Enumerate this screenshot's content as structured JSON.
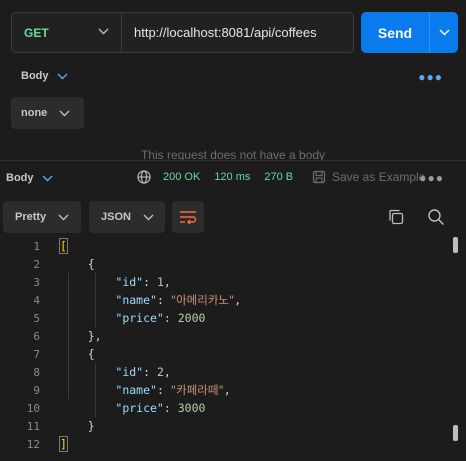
{
  "request": {
    "method": "GET",
    "url": "http://localhost:8081/api/coffees",
    "send_label": "Send"
  },
  "request_body": {
    "tab_label": "Body",
    "type_value": "none",
    "empty_message": "This request does not have a body"
  },
  "response": {
    "tab_label": "Body",
    "status": "200 OK",
    "time": "120 ms",
    "size": "270 B",
    "save_label": "Save as Example",
    "view_mode": "Pretty",
    "format": "JSON"
  },
  "code_lines": [
    {
      "n": "1",
      "parts": [
        [
          "brk",
          "["
        ]
      ]
    },
    {
      "n": "2",
      "parts": [
        [
          "punc",
          "    {"
        ]
      ]
    },
    {
      "n": "3",
      "parts": [
        [
          "punc",
          "        "
        ],
        [
          "key",
          "\"id\""
        ],
        [
          "punc",
          ": "
        ],
        [
          "num",
          "1"
        ],
        [
          "punc",
          ","
        ]
      ]
    },
    {
      "n": "4",
      "parts": [
        [
          "punc",
          "        "
        ],
        [
          "key",
          "\"name\""
        ],
        [
          "punc",
          ": "
        ],
        [
          "str",
          "\"아메리카노\""
        ],
        [
          "punc",
          ","
        ]
      ]
    },
    {
      "n": "5",
      "parts": [
        [
          "punc",
          "        "
        ],
        [
          "key",
          "\"price\""
        ],
        [
          "punc",
          ": "
        ],
        [
          "num",
          "2000"
        ]
      ]
    },
    {
      "n": "6",
      "parts": [
        [
          "punc",
          "    },"
        ]
      ]
    },
    {
      "n": "7",
      "parts": [
        [
          "punc",
          "    {"
        ]
      ]
    },
    {
      "n": "8",
      "parts": [
        [
          "punc",
          "        "
        ],
        [
          "key",
          "\"id\""
        ],
        [
          "punc",
          ": "
        ],
        [
          "num",
          "2"
        ],
        [
          "punc",
          ","
        ]
      ]
    },
    {
      "n": "9",
      "parts": [
        [
          "punc",
          "        "
        ],
        [
          "key",
          "\"name\""
        ],
        [
          "punc",
          ": "
        ],
        [
          "str",
          "\"카페라떼\""
        ],
        [
          "punc",
          ","
        ]
      ]
    },
    {
      "n": "10",
      "parts": [
        [
          "punc",
          "        "
        ],
        [
          "key",
          "\"price\""
        ],
        [
          "punc",
          ": "
        ],
        [
          "num",
          "3000"
        ]
      ]
    },
    {
      "n": "11",
      "parts": [
        [
          "punc",
          "    }"
        ]
      ]
    },
    {
      "n": "12",
      "parts": [
        [
          "brk",
          "]"
        ]
      ]
    }
  ],
  "colors": {
    "accent": "#097bed",
    "status_ok": "#6bdd9a",
    "method_get": "#6bdd9a"
  },
  "icons": [
    "chevron-down-icon",
    "more-icon",
    "globe-icon",
    "save-icon",
    "wrap-lines-icon",
    "copy-icon",
    "search-icon"
  ]
}
